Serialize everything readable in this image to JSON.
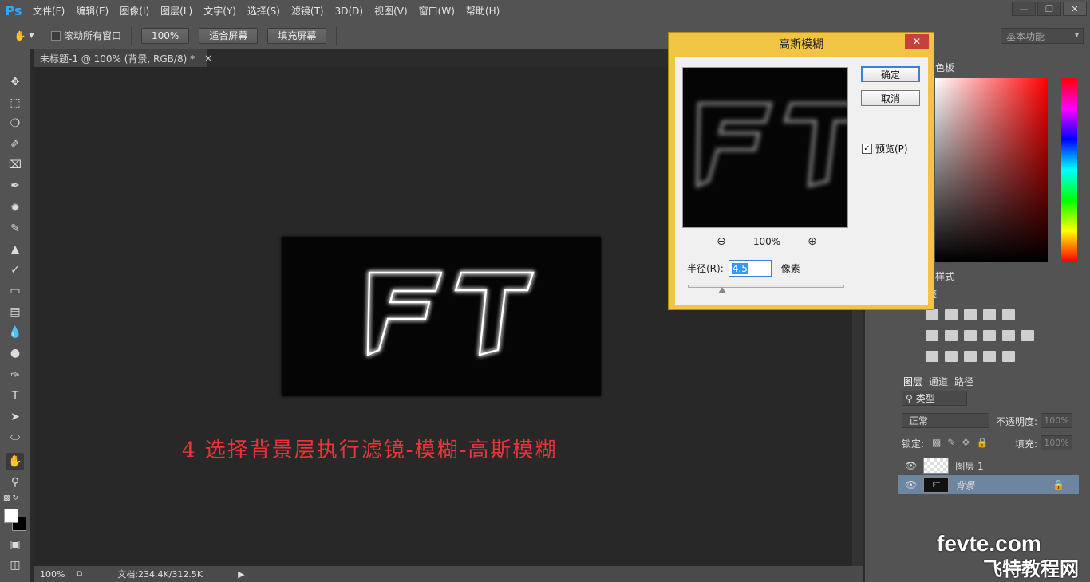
{
  "menubar": {
    "logo": "Ps",
    "items": [
      "文件(F)",
      "编辑(E)",
      "图像(I)",
      "图层(L)",
      "文字(Y)",
      "选择(S)",
      "滤镜(T)",
      "3D(D)",
      "视图(V)",
      "窗口(W)",
      "帮助(H)"
    ]
  },
  "options": {
    "scroll_all_label": "滚动所有窗口",
    "zoom_100": "100%",
    "fit_screen": "适合屏幕",
    "fill_screen": "填充屏幕",
    "workspace": "基本功能"
  },
  "document": {
    "tab_title": "未标题-1 @ 100% (背景, RGB/8) *",
    "canvas_text": "FT",
    "annotation": "4 选择背景层执行滤镜-模糊-高斯模糊",
    "status_zoom": "100%",
    "status_doc": "文档:234.4K/312.5K"
  },
  "dialog": {
    "title": "高斯模糊",
    "ok": "确定",
    "cancel": "取消",
    "preview_label": "预览(P)",
    "preview_checked": true,
    "preview_text": "FT",
    "zoom_value": "100%",
    "radius_label": "半径(R):",
    "radius_value": "4.5",
    "radius_unit": "像素",
    "slider_fraction": 0.22
  },
  "panels": {
    "color_tab": "色板",
    "styles_tab": "样式",
    "adjust_tab": "整",
    "layers_tabs": [
      "图层",
      "通道",
      "路径"
    ],
    "filter_kind": "类型",
    "blend_mode": "正常",
    "opacity_label": "不透明度:",
    "opacity_value": "100%",
    "lock_label": "锁定:",
    "fill_label": "填充:",
    "fill_value": "100%",
    "layers": [
      {
        "name": "图层 1",
        "thumb": "checker",
        "selected": false
      },
      {
        "name": "背景",
        "thumb": "dark",
        "selected": true,
        "thumb_text": "FT"
      }
    ]
  },
  "watermark": {
    "site": "fevte.com",
    "name": "飞特教程网"
  }
}
